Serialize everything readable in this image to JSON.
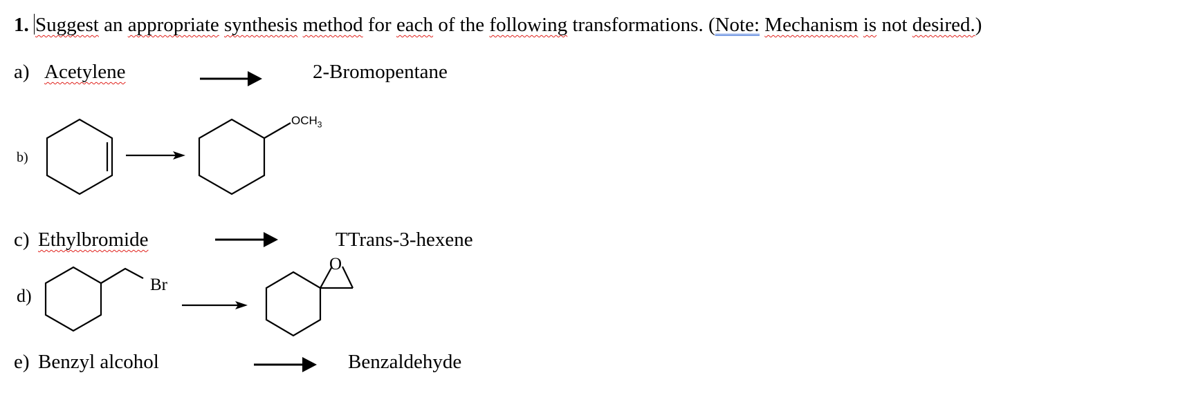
{
  "question": {
    "number": "1.",
    "words": [
      {
        "text": "Suggest",
        "mark": "spell"
      },
      {
        "text": " an ",
        "mark": ""
      },
      {
        "text": "appropriate",
        "mark": "spell"
      },
      {
        "text": " ",
        "mark": ""
      },
      {
        "text": "synthesis",
        "mark": "spell"
      },
      {
        "text": " ",
        "mark": ""
      },
      {
        "text": "method",
        "mark": "spell"
      },
      {
        "text": " for ",
        "mark": ""
      },
      {
        "text": "each",
        "mark": "spell"
      },
      {
        "text": " of the ",
        "mark": ""
      },
      {
        "text": "following",
        "mark": "spell"
      },
      {
        "text": " transformations. (",
        "mark": ""
      },
      {
        "text": "Note:",
        "mark": "grammar"
      },
      {
        "text": " ",
        "mark": ""
      },
      {
        "text": "Mechanism",
        "mark": "spell"
      },
      {
        "text": " ",
        "mark": ""
      },
      {
        "text": "is",
        "mark": "spell"
      },
      {
        "text": " not ",
        "mark": ""
      },
      {
        "text": "desired.",
        "mark": "spell"
      },
      {
        "text": ")",
        "mark": ""
      }
    ]
  },
  "items": {
    "a": {
      "label": "a)",
      "reactant": "Acetylene",
      "product": "2-Bromopentane"
    },
    "b": {
      "label": "b)",
      "reactant": "cyclohexene",
      "product": "methoxycyclohexane",
      "substituent": "OCH",
      "substituent_sub": "3"
    },
    "c": {
      "label": "c)",
      "reactant": "Ethylbromide",
      "product": "TTrans-3-hexene"
    },
    "d": {
      "label": "d)",
      "reactant": "(bromomethyl)cyclohexane",
      "product": "1-oxaspiro[2.5]octane",
      "bromine": "Br",
      "oxygen": "O"
    },
    "e": {
      "label": "e)",
      "reactant": "Benzyl alcohol",
      "product": "Benzaldehyde"
    }
  },
  "colors": {
    "text": "#000000",
    "spellcheck_underline": "#e0201a",
    "grammar_underline": "#3a6fd8",
    "background": "#ffffff"
  }
}
